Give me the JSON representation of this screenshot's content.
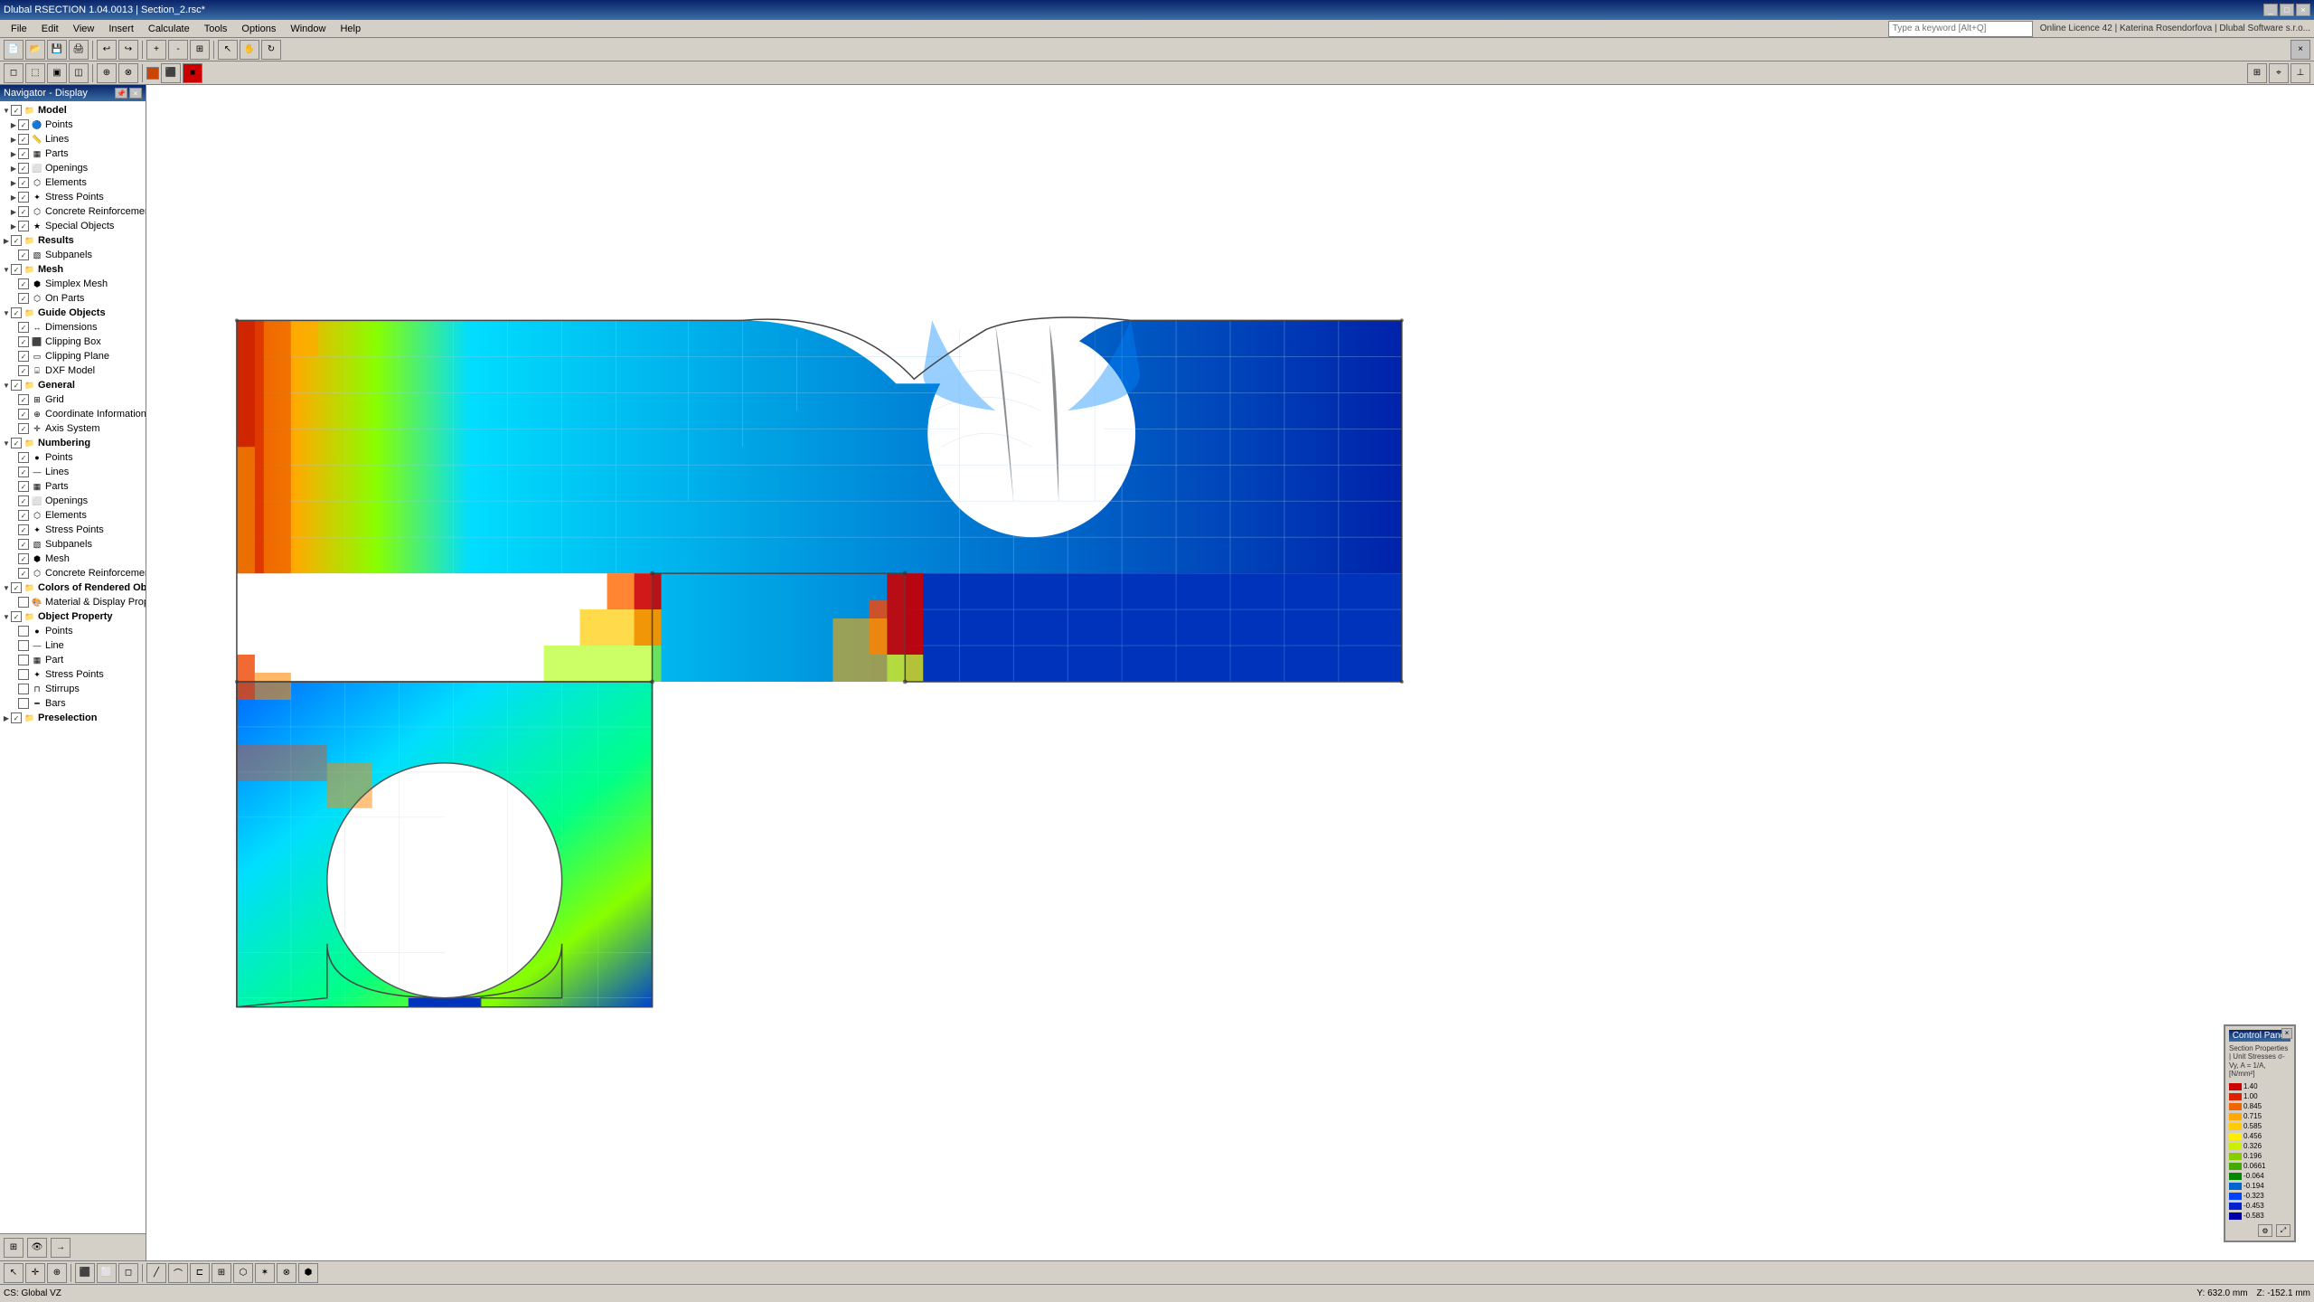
{
  "app": {
    "title": "Dlubal RSECTION 1.04.0013 | Section_2.rsc*",
    "menu_items": [
      "File",
      "Edit",
      "View",
      "Insert",
      "Calculate",
      "Tools",
      "Options",
      "Window",
      "Help"
    ],
    "search_placeholder": "Type a keyword [Alt+Q]",
    "license_text": "Online Licence 42 | Katerina Rosendorfova | Dlubal Software s.r.o..."
  },
  "navigator": {
    "title": "Navigator - Display",
    "items": [
      {
        "id": "model",
        "label": "Model",
        "level": 0,
        "expandable": true,
        "checked": true
      },
      {
        "id": "points",
        "label": "Points",
        "level": 1,
        "expandable": true,
        "checked": true
      },
      {
        "id": "lines",
        "label": "Lines",
        "level": 1,
        "expandable": true,
        "checked": true
      },
      {
        "id": "parts",
        "label": "Parts",
        "level": 1,
        "expandable": true,
        "checked": true
      },
      {
        "id": "openings",
        "label": "Openings",
        "level": 1,
        "expandable": true,
        "checked": true
      },
      {
        "id": "elements",
        "label": "Elements",
        "level": 1,
        "expandable": true,
        "checked": true
      },
      {
        "id": "stress_points",
        "label": "Stress Points",
        "level": 1,
        "expandable": true,
        "checked": true
      },
      {
        "id": "concrete_reinforcement",
        "label": "Concrete Reinforcement",
        "level": 1,
        "expandable": true,
        "checked": true
      },
      {
        "id": "special_objects",
        "label": "Special Objects",
        "level": 1,
        "expandable": true,
        "checked": true
      },
      {
        "id": "results",
        "label": "Results",
        "level": 0,
        "expandable": true,
        "checked": true
      },
      {
        "id": "subpanels",
        "label": "Subpanels",
        "level": 1,
        "expandable": false,
        "checked": true
      },
      {
        "id": "mesh",
        "label": "Mesh",
        "level": 0,
        "expandable": true,
        "checked": true
      },
      {
        "id": "simplex_mesh",
        "label": "Simplex Mesh",
        "level": 1,
        "expandable": false,
        "checked": true
      },
      {
        "id": "on_parts",
        "label": "On Parts",
        "level": 1,
        "expandable": false,
        "checked": true
      },
      {
        "id": "guide_objects",
        "label": "Guide Objects",
        "level": 0,
        "expandable": true,
        "checked": true
      },
      {
        "id": "dimensions",
        "label": "Dimensions",
        "level": 1,
        "expandable": false,
        "checked": true
      },
      {
        "id": "clipping_box",
        "label": "Clipping Box",
        "level": 1,
        "expandable": false,
        "checked": true
      },
      {
        "id": "clipping_plane",
        "label": "Clipping Plane",
        "level": 1,
        "expandable": false,
        "checked": true
      },
      {
        "id": "dxf_model",
        "label": "DXF Model",
        "level": 1,
        "expandable": false,
        "checked": true
      },
      {
        "id": "general",
        "label": "General",
        "level": 0,
        "expandable": true,
        "checked": true
      },
      {
        "id": "grid",
        "label": "Grid",
        "level": 1,
        "expandable": false,
        "checked": true
      },
      {
        "id": "coord_cursor",
        "label": "Coordinate Information on Cursor",
        "level": 1,
        "expandable": false,
        "checked": true
      },
      {
        "id": "axis_system",
        "label": "Axis System",
        "level": 1,
        "expandable": false,
        "checked": true
      },
      {
        "id": "numbering",
        "label": "Numbering",
        "level": 0,
        "expandable": true,
        "checked": true
      },
      {
        "id": "num_points",
        "label": "Points",
        "level": 1,
        "expandable": false,
        "checked": true
      },
      {
        "id": "num_lines",
        "label": "Lines",
        "level": 1,
        "expandable": false,
        "checked": true
      },
      {
        "id": "num_parts",
        "label": "Parts",
        "level": 1,
        "expandable": false,
        "checked": true
      },
      {
        "id": "num_openings",
        "label": "Openings",
        "level": 1,
        "expandable": false,
        "checked": true
      },
      {
        "id": "num_elements",
        "label": "Elements",
        "level": 1,
        "expandable": false,
        "checked": true
      },
      {
        "id": "num_stress_points",
        "label": "Stress Points",
        "level": 1,
        "expandable": false,
        "checked": true
      },
      {
        "id": "num_subpanels",
        "label": "Subpanels",
        "level": 1,
        "expandable": false,
        "checked": true
      },
      {
        "id": "num_mesh",
        "label": "Mesh",
        "level": 1,
        "expandable": false,
        "checked": true
      },
      {
        "id": "num_concrete",
        "label": "Concrete Reinforcement",
        "level": 1,
        "expandable": false,
        "checked": true
      },
      {
        "id": "colors_rendered",
        "label": "Colors of Rendered Objects by",
        "level": 0,
        "expandable": true,
        "checked": true
      },
      {
        "id": "material_display",
        "label": "Material & Display Properties",
        "level": 1,
        "expandable": false,
        "checked": false
      },
      {
        "id": "object_property",
        "label": "Object Property",
        "level": 0,
        "expandable": true,
        "checked": true
      },
      {
        "id": "op_points",
        "label": "Points",
        "level": 1,
        "expandable": false,
        "checked": false
      },
      {
        "id": "op_line",
        "label": "Line",
        "level": 1,
        "expandable": false,
        "checked": false
      },
      {
        "id": "op_part",
        "label": "Part",
        "level": 1,
        "expandable": false,
        "checked": false
      },
      {
        "id": "op_stress_points2",
        "label": "Stress Points",
        "level": 1,
        "expandable": false,
        "checked": false
      },
      {
        "id": "op_stirrups",
        "label": "Stirrups",
        "level": 1,
        "expandable": false,
        "checked": false
      },
      {
        "id": "op_bars",
        "label": "Bars",
        "level": 1,
        "expandable": false,
        "checked": false
      },
      {
        "id": "preselection",
        "label": "Preselection",
        "level": 0,
        "expandable": false,
        "checked": true
      }
    ]
  },
  "legend": {
    "title": "Control Panel",
    "subtitle": "Section Properties | Unit Stresses σ-Vy, A = 1/A, [N/mm²]",
    "entries": [
      {
        "color": "#cc0000",
        "value": "1.40"
      },
      {
        "color": "#dd2200",
        "value": "1.00"
      },
      {
        "color": "#ee6600",
        "value": "0.845"
      },
      {
        "color": "#ffaa00",
        "value": "0.715"
      },
      {
        "color": "#ffcc00",
        "value": "0.585"
      },
      {
        "color": "#ffee00",
        "value": "0.456"
      },
      {
        "color": "#ccee00",
        "value": "0.326"
      },
      {
        "color": "#88cc00",
        "value": "0.196"
      },
      {
        "color": "#44aa00",
        "value": "0.0661"
      },
      {
        "color": "#008800",
        "value": "-0.064"
      },
      {
        "color": "#0066cc",
        "value": "-0.194"
      },
      {
        "color": "#0044ff",
        "value": "-0.323"
      },
      {
        "color": "#0022cc",
        "value": "-0.453"
      },
      {
        "color": "#0000aa",
        "value": "-0.583"
      }
    ]
  },
  "statusbar": {
    "cs_label": "CS: Global VZ",
    "x_coord": "Y: 632.0 mm",
    "z_coord": "Z: -152.1 mm"
  }
}
